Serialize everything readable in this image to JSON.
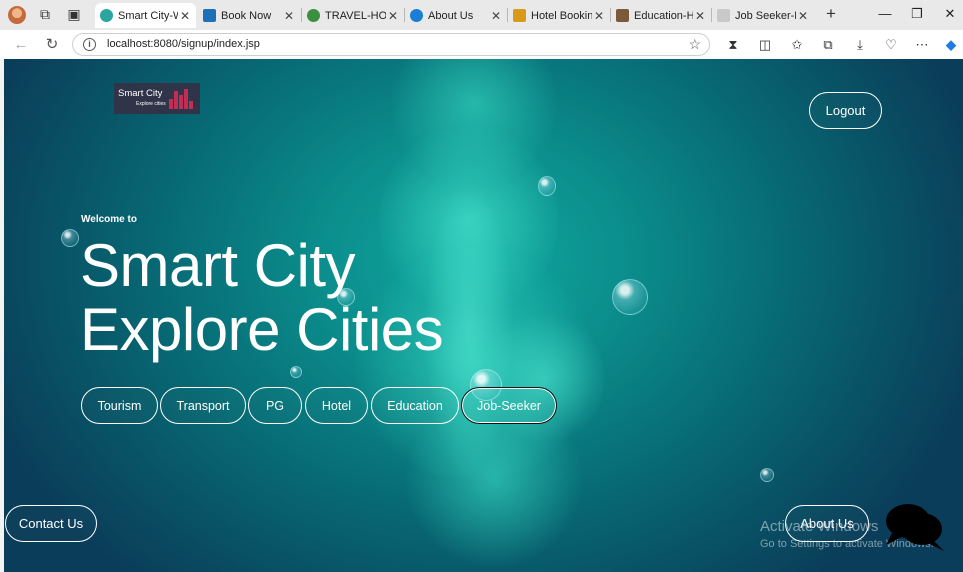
{
  "browser": {
    "tabs": [
      {
        "title": "Smart City-Welc",
        "favicon_color": "#2aa5a0",
        "active": true
      },
      {
        "title": "Book Now",
        "favicon_color": "#1d6fb8",
        "active": false
      },
      {
        "title": "TRAVEL-HOME",
        "favicon_color": "#3b8f3e",
        "active": false
      },
      {
        "title": "About Us",
        "favicon_color": "#1a7fd4",
        "active": false
      },
      {
        "title": "Hotel Booking",
        "favicon_color": "#d99a1c",
        "active": false
      },
      {
        "title": "Education-Hom",
        "favicon_color": "#7a5a3a",
        "active": false
      },
      {
        "title": "Job Seeker-Hor",
        "favicon_color": "#c9c9c9",
        "active": false
      }
    ],
    "url": "localhost:8080/signup/index.jsp"
  },
  "page": {
    "logo": {
      "title": "Smart City",
      "subtitle": "Explore cities"
    },
    "logout_label": "Logout",
    "welcome": "Welcome to",
    "title_line1": "Smart City",
    "title_line2": "Explore Cities",
    "nav_buttons": [
      "Tourism",
      "Transport",
      "PG",
      "Hotel",
      "Education",
      "Job-Seeker"
    ],
    "contact_label": "Contact Us",
    "about_label": "About Us",
    "watermark_title": "Activate Windows",
    "watermark_sub": "Go to Settings to activate Windows.",
    "accent": "#0b8d8c"
  }
}
